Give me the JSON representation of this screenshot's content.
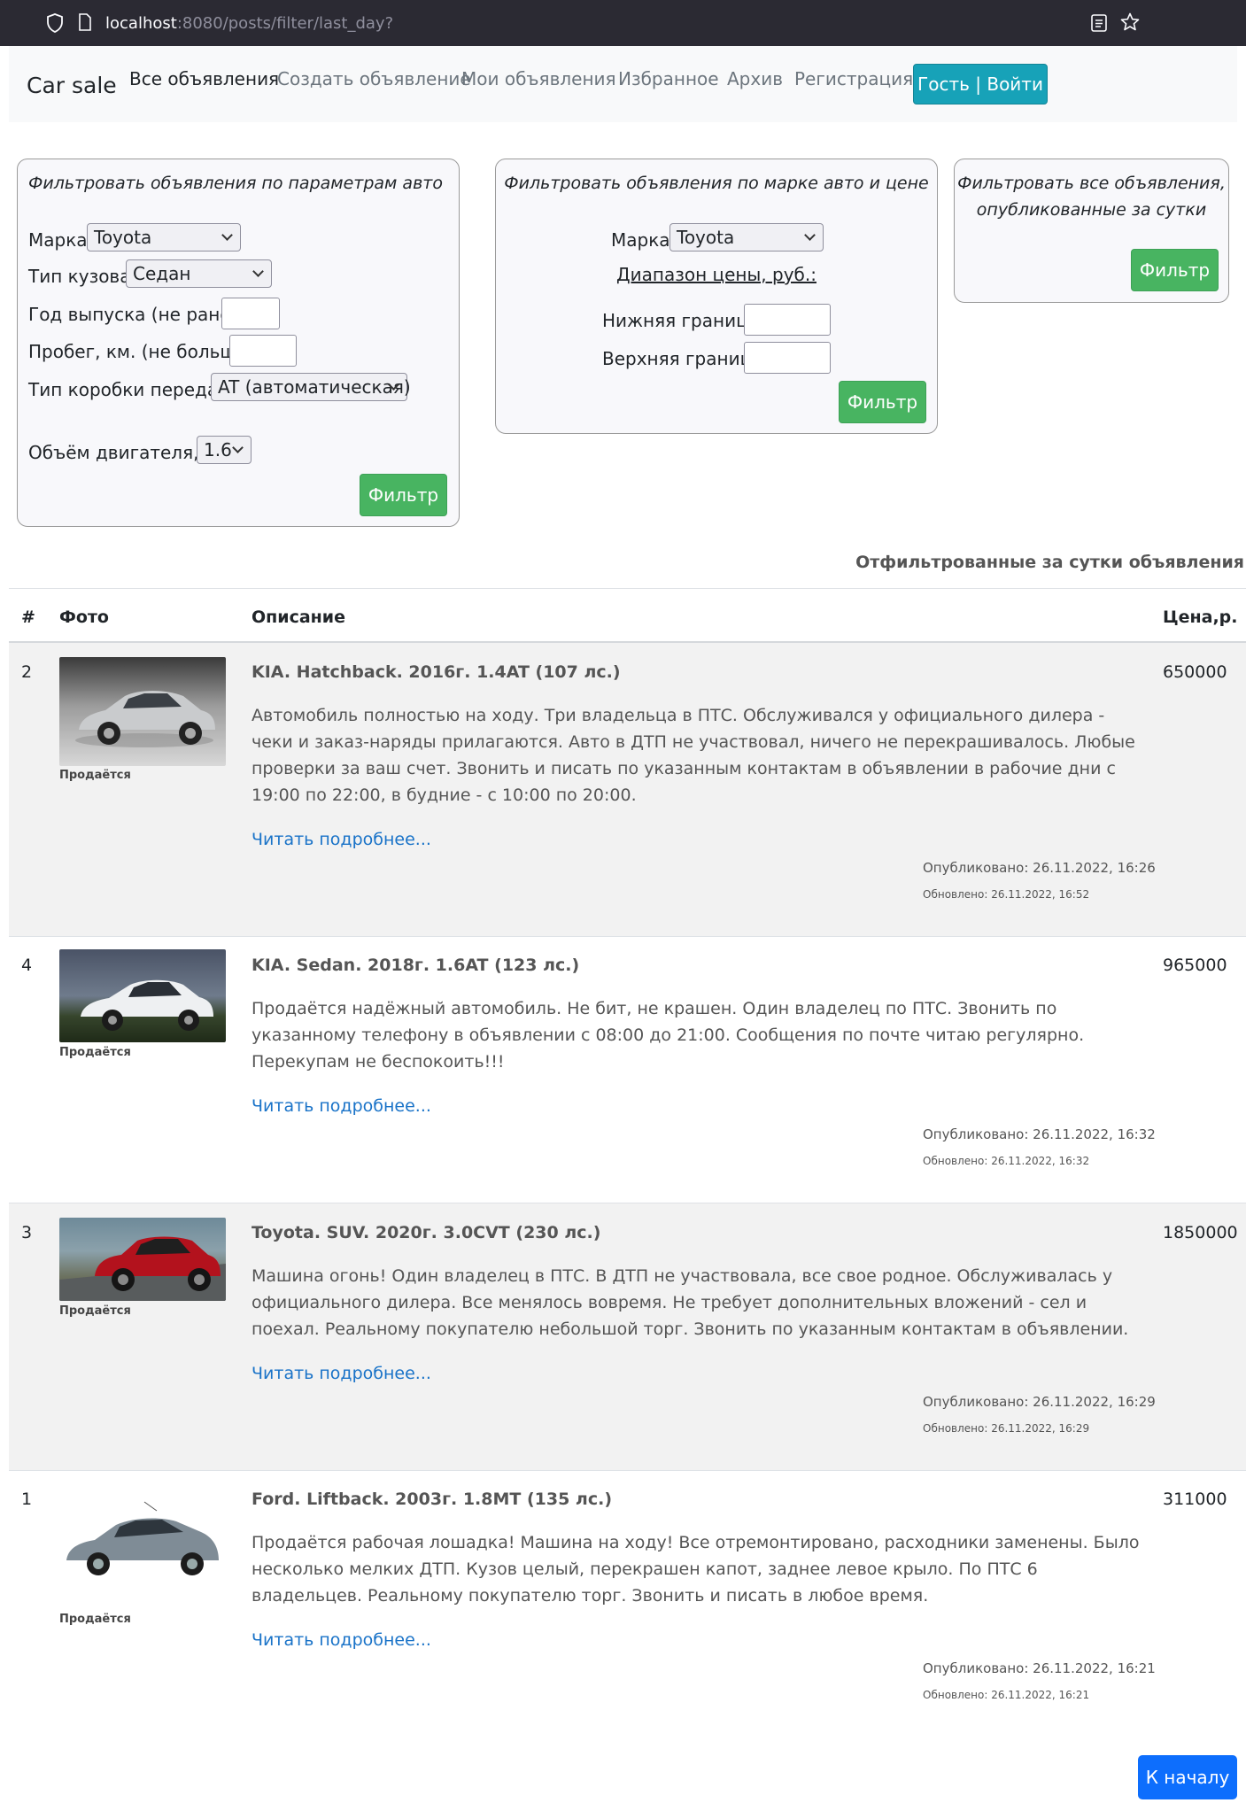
{
  "browser": {
    "url_host": "localhost",
    "url_rest": ":8080/posts/filter/last_day?"
  },
  "navbar": {
    "brand": "Car sale",
    "links": [
      "Все объявления",
      "Создать объявление",
      "Мои объявления",
      "Избранное",
      "Архив",
      "Регистрация"
    ],
    "active_index": 0,
    "login_label": "Гость | Войти"
  },
  "filters": {
    "params": {
      "title": "Фильтровать объявления по параметрам авто",
      "brand_label": "Марка",
      "brand_value": "Toyota",
      "body_label": "Тип кузова:",
      "body_value": "Седан",
      "year_label": "Год выпуска (не ранее)",
      "mileage_label": "Пробег, км. (не больше)",
      "gearbox_label": "Тип коробки передач",
      "gearbox_value": "AT (автоматическая)",
      "engine_label": "Объём двигателя, л.",
      "engine_value": "1.6",
      "button": "Фильтр"
    },
    "price": {
      "title": "Фильтровать объявления по марке авто и цене",
      "brand_label": "Марка",
      "brand_value": "Toyota",
      "range_label": "Диапазон цены, руб.:",
      "min_label": "Нижняя граница",
      "max_label": "Верхняя граница",
      "button": "Фильтр"
    },
    "day": {
      "title_line1": "Фильтровать все объявления,",
      "title_line2": "опубликованные за сутки",
      "button": "Фильтр"
    }
  },
  "table": {
    "caption": "Отфильтрованные за сутки объявления",
    "headers": [
      "#",
      "Фото",
      "Описание",
      "Цена,р."
    ],
    "rows": [
      {
        "num": "2",
        "status": "Продаётся",
        "title": "KIA. Hatchback. 2016г. 1.4AT (107 лс.)",
        "desc": "Автомобиль полностью на ходу. Три владельца в ПТС. Обслуживался у официального дилера - чеки и заказ-наряды прилагаются. Авто в ДТП не участвовал, ничего не перекрашивалось. Любые проверки за ваш счет. Звонить и писать по указанным контактам в объявлении в рабочие дни с 19:00 по 22:00, в будние - с 10:00 по 20:00.",
        "link": "Читать подробнее...",
        "published": "Опубликовано: 26.11.2022, 16:26",
        "updated": "Обновлено: 26.11.2022, 16:52",
        "price": "650000",
        "car_color": "#c9cbcd"
      },
      {
        "num": "4",
        "status": "Продаётся",
        "title": "KIA. Sedan. 2018г. 1.6AT (123 лс.)",
        "desc": "Продаётся надёжный автомобиль. Не бит, не крашен. Один владелец по ПТС. Звонить по указанному телефону в объявлении с 08:00 до 21:00. Сообщения по почте читаю регулярно. Перекупам не беспокоить!!!",
        "link": "Читать подробнее...",
        "published": "Опубликовано: 26.11.2022, 16:32",
        "updated": "Обновлено: 26.11.2022, 16:32",
        "price": "965000",
        "car_color": "#eef0f2"
      },
      {
        "num": "3",
        "status": "Продаётся",
        "title": "Toyota. SUV. 2020г. 3.0CVT (230 лс.)",
        "desc": "Машина огонь! Один владелец в ПТС. В ДТП не участвовала, все свое родное. Обслуживалась у официального дилера. Все менялось вовремя. Не требует дополнительных вложений - сел и поехал. Реальному покупателю небольшой торг. Звонить по указанным контактам в объявлении.",
        "link": "Читать подробнее...",
        "published": "Опубликовано: 26.11.2022, 16:29",
        "updated": "Обновлено: 26.11.2022, 16:29",
        "price": "1850000",
        "car_color": "#b3121d"
      },
      {
        "num": "1",
        "status": "Продаётся",
        "title": "Ford. Liftback. 2003г. 1.8MT (135 лс.)",
        "desc": "Продаётся рабочая лошадка! Машина на ходу! Все отремонтировано, расходники заменены. Было несколько мелких ДТП. Кузов целый, перекрашен капот, заднее левое крыло. По ПТС 6 владельцев. Реальному покупателю торг. Звонить и писать в любое время.",
        "link": "Читать подробнее...",
        "published": "Опубликовано: 26.11.2022, 16:21",
        "updated": "Обновлено: 26.11.2022, 16:21",
        "price": "311000",
        "car_color": "#7f8c96"
      }
    ]
  },
  "footer": {
    "to_top": "К началу"
  }
}
